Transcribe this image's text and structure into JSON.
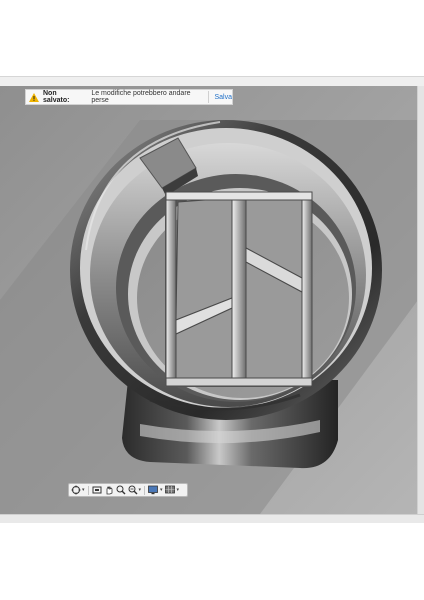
{
  "notification": {
    "title": "Non salvato:",
    "message": "Le modifiche potrebbero andare perse",
    "action": "Salva",
    "icon": "warning-icon",
    "accent": "#1e6fc7",
    "warn_color": "#f0b400"
  },
  "navigation_toolbar": {
    "tools": [
      {
        "name": "orbit-icon",
        "has_menu": true
      },
      {
        "name": "look-at-icon",
        "has_menu": false
      },
      {
        "name": "pan-icon",
        "has_menu": false
      },
      {
        "name": "zoom-icon",
        "has_menu": false
      },
      {
        "name": "fit-icon",
        "has_menu": true
      },
      {
        "name": "display-settings-icon",
        "has_menu": true
      },
      {
        "name": "grid-settings-icon",
        "has_menu": true
      }
    ]
  }
}
